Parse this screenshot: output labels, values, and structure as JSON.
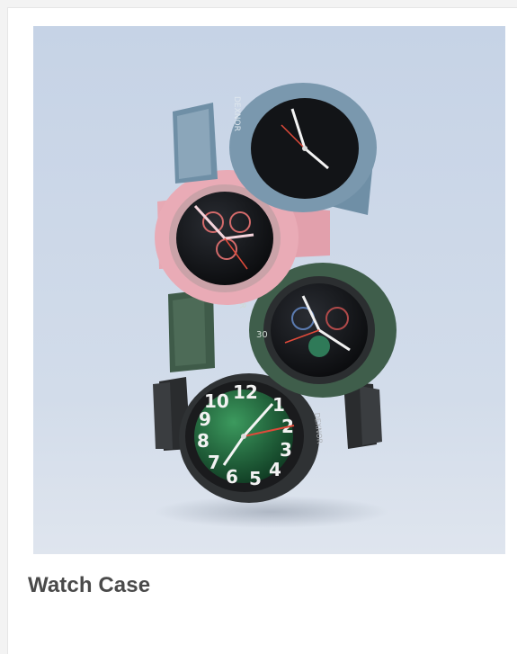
{
  "product": {
    "caption": "Watch Case",
    "brand_text": "DEXNOR"
  },
  "image": {
    "subject": "stack-of-four-smartwatches-in-protective-cases",
    "case_colors": [
      "#6f8fa6",
      "#e7a9b4",
      "#3f5e4b",
      "#2f3234"
    ],
    "background_color": "#c9d6e8"
  }
}
